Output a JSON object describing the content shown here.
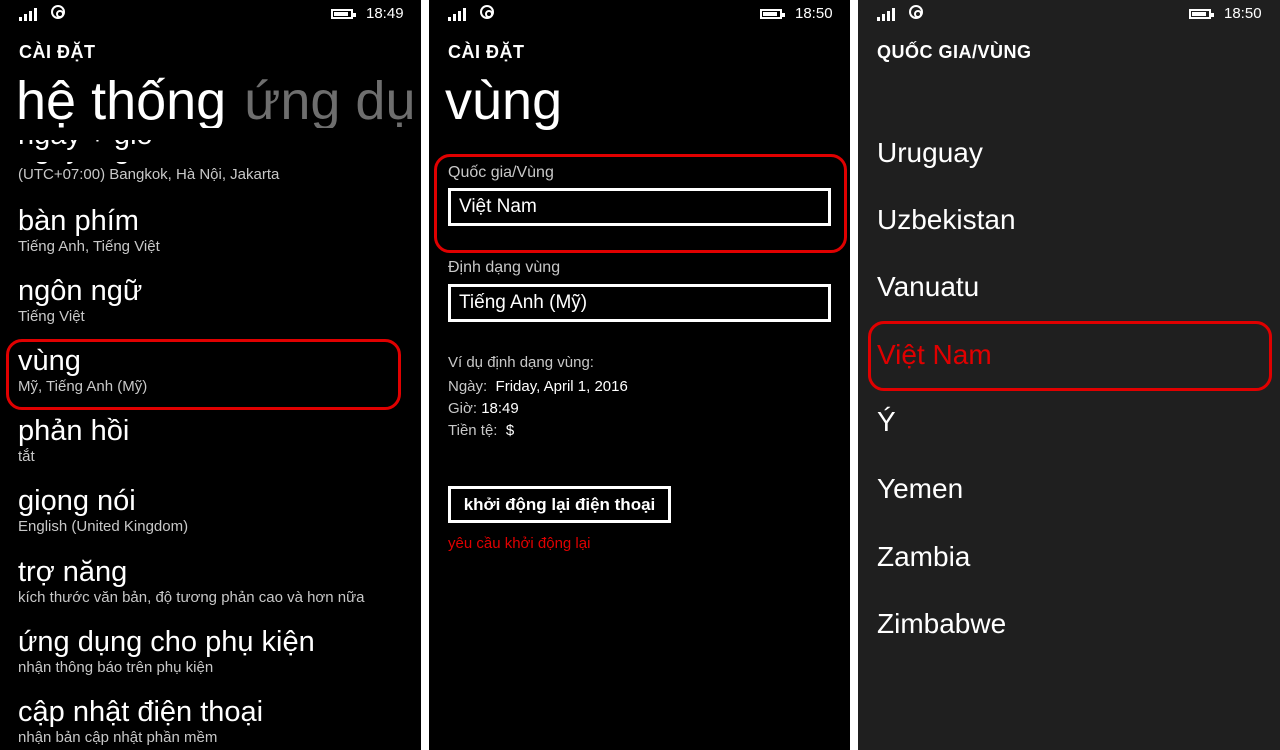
{
  "colors": {
    "accent": "#e00000",
    "background": "#000000",
    "panel3_background": "#1f1f1f"
  },
  "icons": [
    "signal-icon",
    "wifi-icon",
    "battery-icon"
  ],
  "screen1": {
    "time": "18:49",
    "header": "CÀI ĐẶT",
    "pivot_active": "hệ thống",
    "pivot_next": "ứng dụ",
    "items": [
      {
        "title": "ngày + giờ",
        "subtitle": "(UTC+07:00) Bangkok, Hà Nội, Jakarta"
      },
      {
        "title": "bàn phím",
        "subtitle": "Tiếng Anh, Tiếng Việt"
      },
      {
        "title": "ngôn ngữ",
        "subtitle": "Tiếng Việt"
      },
      {
        "title": "vùng",
        "subtitle": "Mỹ, Tiếng Anh (Mỹ)"
      },
      {
        "title": "phản hồi",
        "subtitle": "tắt"
      },
      {
        "title": "giọng nói",
        "subtitle": "English (United Kingdom)"
      },
      {
        "title": "trợ năng",
        "subtitle": "kích thước văn bản, độ tương phản cao và hơn nữa"
      },
      {
        "title": "ứng dụng cho phụ kiện",
        "subtitle": "nhận thông báo trên phụ kiện"
      },
      {
        "title": "cập nhật điện thoại",
        "subtitle": "nhận bản cập nhật phần mềm"
      }
    ]
  },
  "screen2": {
    "time": "18:50",
    "header": "CÀI ĐẶT",
    "title": "vùng",
    "country_label": "Quốc gia/Vùng",
    "country_value": "Việt Nam",
    "format_label": "Định dạng vùng",
    "format_value": "Tiếng Anh (Mỹ)",
    "example_heading": "Ví dụ định dạng vùng:",
    "date_label": "Ngày:",
    "date_value": "Friday, April 1, 2016",
    "time_label": "Giờ:",
    "time_value": "18:49",
    "currency_label": "Tiền tệ:",
    "currency_value": "$",
    "restart_button": "khởi động lại điện thoại",
    "restart_note": "yêu cầu khởi động lại"
  },
  "screen3": {
    "time": "18:50",
    "header": "QUỐC GIA/VÙNG",
    "countries": [
      "Uruguay",
      "Uzbekistan",
      "Vanuatu",
      "Việt Nam",
      "Ý",
      "Yemen",
      "Zambia",
      "Zimbabwe"
    ],
    "selected": "Việt Nam"
  }
}
